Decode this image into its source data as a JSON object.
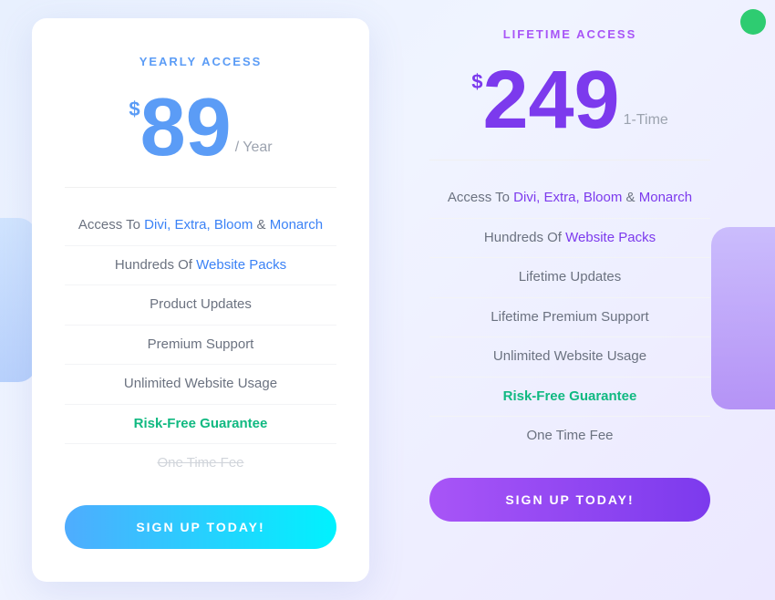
{
  "background": {
    "circle_color": "#2ecc71"
  },
  "yearly": {
    "title": "YEARLY ACCESS",
    "price_dollar": "$",
    "price_amount": "89",
    "price_period": "/ Year",
    "features": [
      {
        "text_before": "Access To ",
        "link_text": "Divi, Extra, Bloom",
        "text_mid": " & ",
        "link_text2": "Monarch",
        "text_after": ""
      },
      {
        "text_before": "Hundreds Of ",
        "link_text": "Website Packs",
        "text_after": ""
      },
      {
        "plain": "Product Updates"
      },
      {
        "plain": "Premium Support"
      },
      {
        "plain": "Unlimited Website Usage"
      },
      {
        "green_link": "Risk-Free Guarantee"
      },
      {
        "strikethrough": "One Time Fee"
      }
    ],
    "button_label": "SIGN UP TODAY!"
  },
  "lifetime": {
    "title": "LIFETIME ACCESS",
    "price_dollar": "$",
    "price_amount": "249",
    "price_period": "1-Time",
    "features": [
      {
        "text_before": "Access To ",
        "link_text": "Divi, Extra, Bloom",
        "text_mid": " & ",
        "link_text2": "Monarch",
        "text_after": ""
      },
      {
        "text_before": "Hundreds Of ",
        "link_text": "Website Packs",
        "text_after": ""
      },
      {
        "plain": "Lifetime Updates"
      },
      {
        "plain": "Lifetime Premium Support"
      },
      {
        "plain": "Unlimited Website Usage"
      },
      {
        "green_link": "Risk-Free Guarantee"
      },
      {
        "plain": "One Time Fee"
      }
    ],
    "button_label": "SIGN UP TODAY!"
  }
}
